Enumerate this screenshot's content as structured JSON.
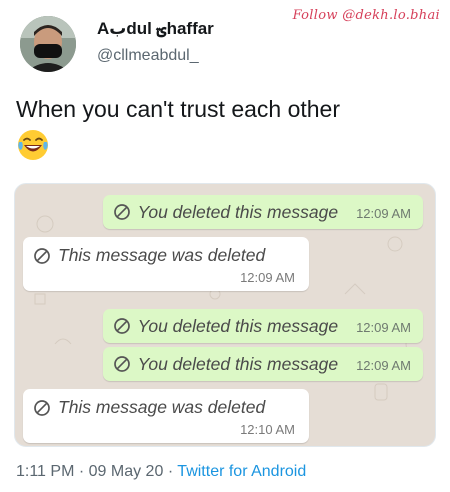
{
  "author": {
    "display_name": "Aبdul ؾhaffar",
    "handle": "@cllmeabdul_"
  },
  "watermark": "Follow @dekh.lo.bhai",
  "tweet": {
    "text": "When you can't trust each other",
    "emoji": "face-with-tears-of-joy"
  },
  "chat": {
    "messages": [
      {
        "direction": "out",
        "text": "You deleted this message",
        "time": "12:09 AM"
      },
      {
        "direction": "in",
        "text": "This message was deleted",
        "time": "12:09 AM"
      },
      {
        "direction": "out",
        "text": "You deleted this message",
        "time": "12:09 AM"
      },
      {
        "direction": "out",
        "text": "You deleted this message",
        "time": "12:09 AM"
      },
      {
        "direction": "in",
        "text": "This message was deleted",
        "time": "12:10 AM"
      }
    ]
  },
  "meta": {
    "time": "1:11 PM",
    "separator": "·",
    "date": "09 May 20",
    "source": "Twitter for Android"
  },
  "colors": {
    "outgoing_bubble": "#dcf8c6",
    "incoming_bubble": "#ffffff",
    "chat_background": "#e5ddd5",
    "link": "#1b95e0",
    "watermark": "#d6405a"
  }
}
